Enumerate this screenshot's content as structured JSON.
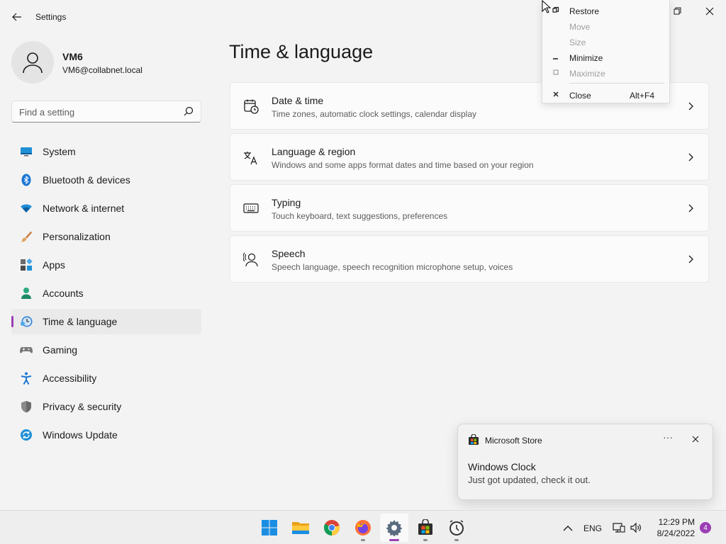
{
  "window": {
    "title": "Settings",
    "back_icon": "back-arrow-icon",
    "restore_icon": "restore-icon",
    "close_icon": "close-icon"
  },
  "profile": {
    "name": "VM6",
    "email": "VM6@collabnet.local",
    "avatar_icon": "person-icon"
  },
  "search": {
    "placeholder": "Find a setting",
    "value": "",
    "icon": "search-icon"
  },
  "nav": {
    "items": [
      {
        "label": "System",
        "icon": "system-icon",
        "active": false
      },
      {
        "label": "Bluetooth & devices",
        "icon": "bluetooth-icon",
        "active": false
      },
      {
        "label": "Network & internet",
        "icon": "wifi-icon",
        "active": false
      },
      {
        "label": "Personalization",
        "icon": "brush-icon",
        "active": false
      },
      {
        "label": "Apps",
        "icon": "apps-icon",
        "active": false
      },
      {
        "label": "Accounts",
        "icon": "accounts-icon",
        "active": false
      },
      {
        "label": "Time & language",
        "icon": "time-language-icon",
        "active": true
      },
      {
        "label": "Gaming",
        "icon": "gamepad-icon",
        "active": false
      },
      {
        "label": "Accessibility",
        "icon": "accessibility-icon",
        "active": false
      },
      {
        "label": "Privacy & security",
        "icon": "shield-icon",
        "active": false
      },
      {
        "label": "Windows Update",
        "icon": "update-icon",
        "active": false
      }
    ],
    "accent": "#9b3fb5"
  },
  "main": {
    "title": "Time & language",
    "cards": [
      {
        "title": "Date & time",
        "description": "Time zones, automatic clock settings, calendar display",
        "icon": "calendar-clock-icon"
      },
      {
        "title": "Language & region",
        "description": "Windows and some apps format dates and time based on your region",
        "icon": "language-icon"
      },
      {
        "title": "Typing",
        "description": "Touch keyboard, text suggestions, preferences",
        "icon": "keyboard-icon"
      },
      {
        "title": "Speech",
        "description": "Speech language, speech recognition microphone setup, voices",
        "icon": "speech-icon"
      }
    ]
  },
  "context_menu": {
    "items": [
      {
        "label": "Restore",
        "glyph": "restore-icon",
        "enabled": true,
        "shortcut": ""
      },
      {
        "label": "Move",
        "glyph": "",
        "enabled": false,
        "shortcut": ""
      },
      {
        "label": "Size",
        "glyph": "",
        "enabled": false,
        "shortcut": ""
      },
      {
        "label": "Minimize",
        "glyph": "minimize-icon",
        "enabled": true,
        "shortcut": ""
      },
      {
        "label": "Maximize",
        "glyph": "maximize-icon",
        "enabled": false,
        "shortcut": ""
      },
      {
        "label": "Close",
        "glyph": "close-icon",
        "enabled": true,
        "shortcut": "Alt+F4"
      }
    ]
  },
  "toast": {
    "app_name": "Microsoft Store",
    "more": "···",
    "title": "Windows Clock",
    "body": "Just got updated, check it out."
  },
  "taskbar": {
    "apps": [
      {
        "name": "Start",
        "icon": "windows-start-icon",
        "active": false,
        "running": false
      },
      {
        "name": "File Explorer",
        "icon": "folder-icon",
        "active": false,
        "running": false
      },
      {
        "name": "Google Chrome",
        "icon": "chrome-icon",
        "active": false,
        "running": false
      },
      {
        "name": "Firefox",
        "icon": "firefox-icon",
        "active": false,
        "running": true
      },
      {
        "name": "Settings",
        "icon": "settings-gear-icon",
        "active": true,
        "running": true
      },
      {
        "name": "Microsoft Store",
        "icon": "store-icon",
        "active": false,
        "running": true
      },
      {
        "name": "Windows Clock",
        "icon": "clock-icon",
        "active": false,
        "running": true
      }
    ],
    "tray": {
      "language": "ENG",
      "time": "12:29 PM",
      "date": "8/24/2022",
      "notification_count": "4"
    }
  }
}
